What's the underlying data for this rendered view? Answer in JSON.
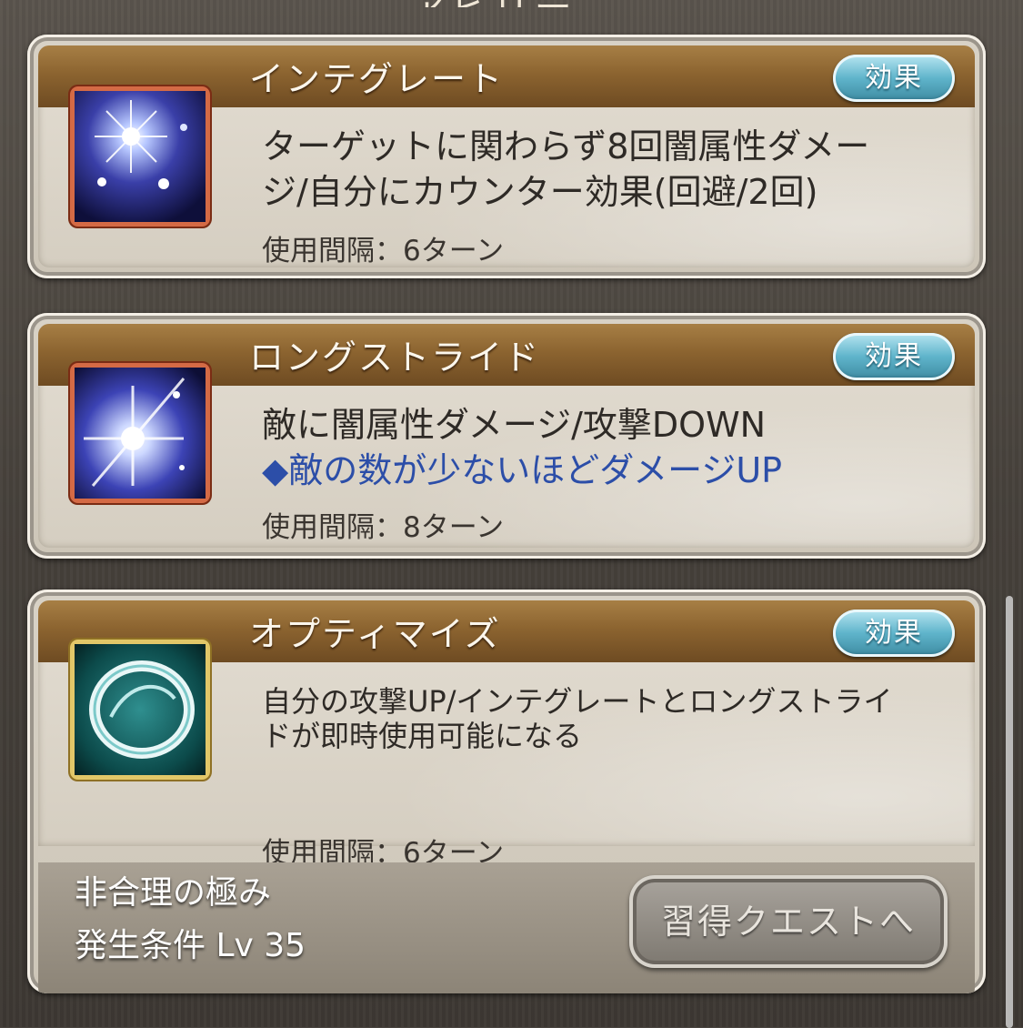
{
  "top_partial_title": "アビリティ",
  "abilities": [
    {
      "name": "インテグレート",
      "effect_button": "効果",
      "icon": "dark-starburst-icon",
      "description_line1": "ターゲットに関わらず8回闇属性ダメー",
      "description_line2": "ジ/自分にカウンター効果(回避/2回)",
      "note": "",
      "interval": "使用間隔：6ターン"
    },
    {
      "name": "ロングストライド",
      "effect_button": "効果",
      "icon": "light-slash-icon",
      "description_line1": "敵に闇属性ダメージ/攻撃DOWN",
      "note": "◆敵の数が少ないほどダメージUP",
      "interval": "使用間隔：8ターン"
    },
    {
      "name": "オプティマイズ",
      "effect_button": "効果",
      "icon": "teal-ring-icon",
      "description_line1": "自分の攻撃UP/インテグレートとロングストライ",
      "description_line2": "ドが即時使用可能になる",
      "interval": "使用間隔：6ターン",
      "skill_name": "非合理の極み",
      "condition": "発生条件 Lv 35",
      "quest_button": "習得クエストへ"
    }
  ],
  "colors": {
    "title_bar": "#8c6430",
    "effect_button": "#5fb4cb",
    "note_text": "#2c4ea8"
  }
}
